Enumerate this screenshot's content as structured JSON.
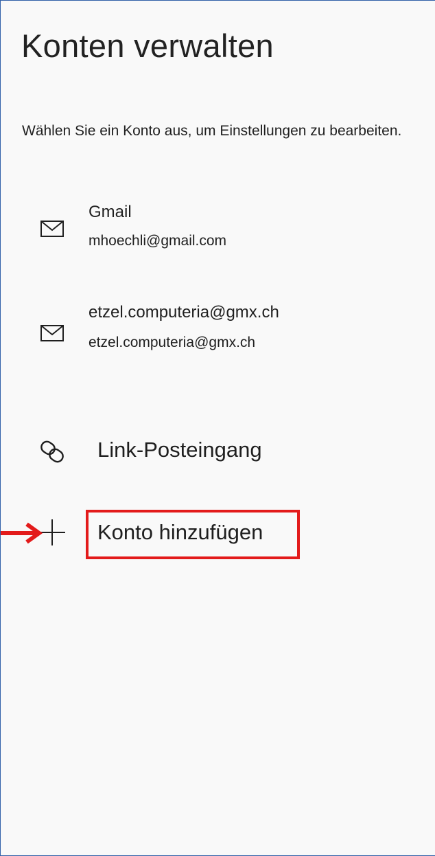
{
  "header": {
    "title": "Konten verwalten",
    "subtitle": "Wählen Sie ein Konto aus, um Einstellungen zu bearbeiten."
  },
  "accounts": [
    {
      "name": "Gmail",
      "email": "mhoechli@gmail.com",
      "icon": "mail-icon"
    },
    {
      "name": "etzel.computeria@gmx.ch",
      "email": "etzel.computeria@gmx.ch",
      "icon": "mail-icon"
    }
  ],
  "actions": {
    "link_inbox_label": "Link-Posteingang",
    "link_inbox_icon": "link-icon",
    "add_account_label": "Konto hinzufügen",
    "add_account_icon": "plus-icon"
  },
  "annotation": {
    "highlight_color": "#e31b1b",
    "arrow_color": "#e31b1b"
  },
  "colors": {
    "panel_background": "#f9f9f9",
    "panel_border": "#2f5fa8",
    "text": "#1f1f1f"
  }
}
